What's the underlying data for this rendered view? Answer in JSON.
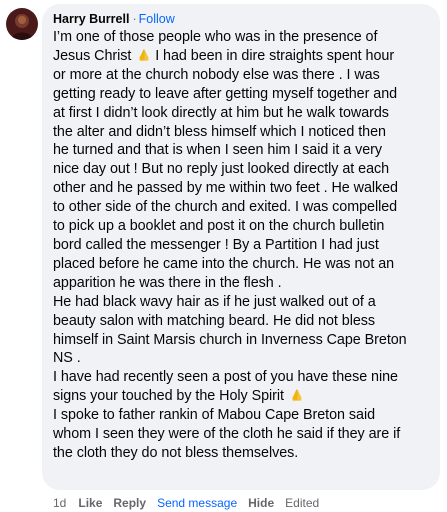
{
  "comment": {
    "author": "Harry Burrell",
    "separator": "·",
    "follow_label": "Follow",
    "lines": [
      "I’m one of those people who was in the presence of",
      "Jesus Christ",
      "I had been in dire straights spent hour",
      "or more at the church nobody else was there . I was",
      "getting ready to leave after getting myself together and",
      "at first I didn’t look directly at him but he walk towards",
      "the alter and didn’t bless himself which I noticed then",
      "he turned and that is when I seen him I said it a very",
      "nice day out ! But no reply just looked directly at each",
      "other and he passed by me within two feet . He walked",
      "to other side of the church and exited. I was compelled",
      "to pick up a booklet and post it on the church bulletin",
      "bord called the messenger ! By a Partition I had just",
      "placed before he came into the church. He was not an",
      "apparition he was there in the flesh .",
      "He had black wavy hair as if he just walked out of a",
      "beauty salon with matching beard. He did not bless",
      "himself in Saint Marsis church in Inverness Cape Breton",
      "NS .",
      "I have had recently seen a post of you have these nine",
      "signs your touched by the Holy Spirit",
      "I spoke to father rankin of Mabou Cape Breton said",
      "whom I seen they were of the cloth he said if they are if",
      "the cloth they do not bless themselves."
    ]
  },
  "actions": {
    "time": "1d",
    "like": "Like",
    "reply": "Reply",
    "send_message": "Send message",
    "hide": "Hide",
    "edited": "Edited"
  },
  "colors": {
    "bubble_bg": "#f0f2f5",
    "link_blue": "#0866ff",
    "secondary_text": "#65676b",
    "primary_text": "#050505",
    "emoji_yellow": "#f4b400"
  },
  "icons": {
    "praying_hands": "praying-hands-emoji"
  }
}
